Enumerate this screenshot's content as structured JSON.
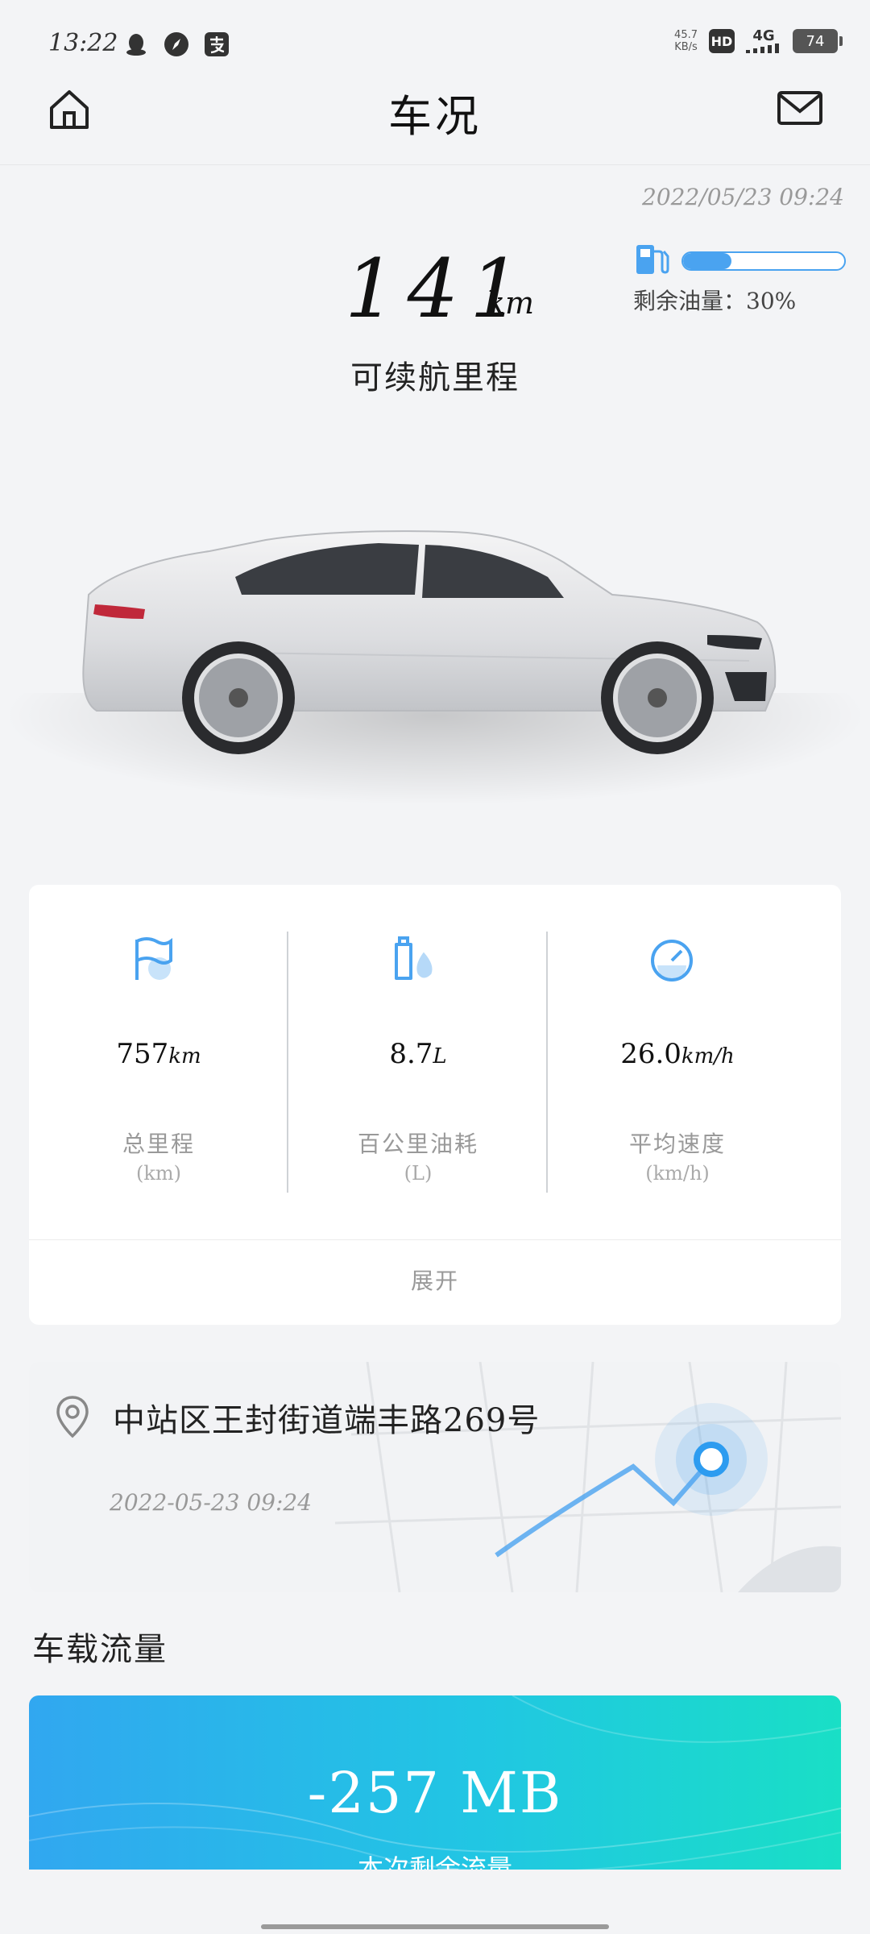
{
  "status_bar": {
    "time": "13:22",
    "speed_value": "45.7",
    "speed_unit": "KB/s",
    "hd": "HD",
    "network": "4G",
    "battery": "74",
    "icons": [
      "qq-penguin-icon",
      "compass-icon",
      "alipay-icon"
    ]
  },
  "header": {
    "title": "车况",
    "left_icon": "home-icon",
    "right_icon": "mail-icon"
  },
  "summary": {
    "timestamp": "2022/05/23 09:24",
    "range_value": "141",
    "range_unit": "km",
    "range_label": "可续航里程",
    "fuel_percent": 30,
    "fuel_text": "剩余油量：30%",
    "fuel_color": "#4aa3f0"
  },
  "stats": {
    "items": [
      {
        "icon": "flag-icon",
        "value": "757",
        "value_unit": "km",
        "label": "总里程",
        "unit": "(km)"
      },
      {
        "icon": "oil-can-icon",
        "value": "8.7",
        "value_unit": "L",
        "label": "百公里油耗",
        "unit": "(L)"
      },
      {
        "icon": "speedometer-icon",
        "value": "26.0",
        "value_unit": "km/h",
        "label": "平均速度",
        "unit": "(km/h)"
      }
    ],
    "expand_label": "展开"
  },
  "location": {
    "address": "中站区王封街道端丰路269号",
    "time": "2022-05-23 09:24"
  },
  "data_section": {
    "title": "车载流量",
    "value": "-257 MB",
    "subtitle": "本次剩余流量"
  }
}
